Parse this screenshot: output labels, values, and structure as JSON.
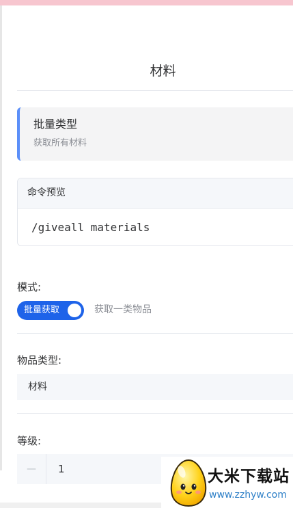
{
  "page": {
    "title": "材料"
  },
  "info_card": {
    "title": "批量类型",
    "description": "获取所有材料"
  },
  "command_preview": {
    "header": "命令预览",
    "command": "/giveall materials"
  },
  "mode": {
    "label": "模式:",
    "toggle_label": "批量获取",
    "toggle_on": true,
    "alt_description": "获取一类物品"
  },
  "item_type": {
    "label": "物品类型:",
    "value": "材料"
  },
  "level": {
    "label": "等级:",
    "minus_symbol": "—",
    "value": "1"
  },
  "watermark": {
    "title": "大米下载站",
    "url": "www.zzhyw.com"
  },
  "colors": {
    "accent": "#1e63e9",
    "info_border": "#5b8ff9",
    "status_bar": "#f7c6cf"
  }
}
